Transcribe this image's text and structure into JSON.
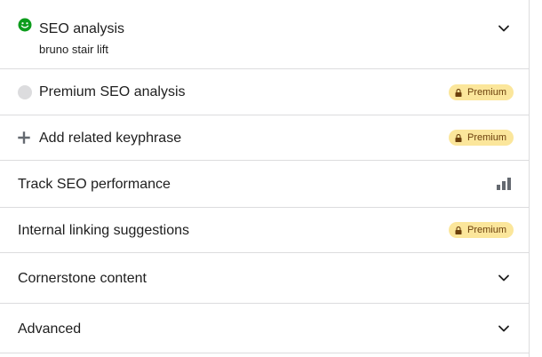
{
  "panel": {
    "rows": [
      {
        "label": "SEO analysis",
        "sublabel": "bruno stair lift",
        "lead_icon": "smiley-face-icon",
        "lead_color": "#0c9c1c",
        "trail_icon": "chevron-down-icon"
      },
      {
        "label": "Premium SEO analysis",
        "lead_icon": "gray-circle-icon",
        "trail_badge": "Premium"
      },
      {
        "label": "Add related keyphrase",
        "lead_icon": "plus-icon",
        "trail_badge": "Premium"
      },
      {
        "label": "Track SEO performance",
        "trail_icon": "bar-chart-icon"
      },
      {
        "label": "Internal linking suggestions",
        "trail_badge": "Premium"
      },
      {
        "label": "Cornerstone content",
        "trail_icon": "chevron-down-icon"
      },
      {
        "label": "Advanced",
        "trail_icon": "chevron-down-icon"
      }
    ]
  },
  "colors": {
    "badge_bg": "#fbe69b",
    "badge_text": "#6b3f0b",
    "divider": "#dcdcde",
    "icon_gray": "#646970"
  }
}
